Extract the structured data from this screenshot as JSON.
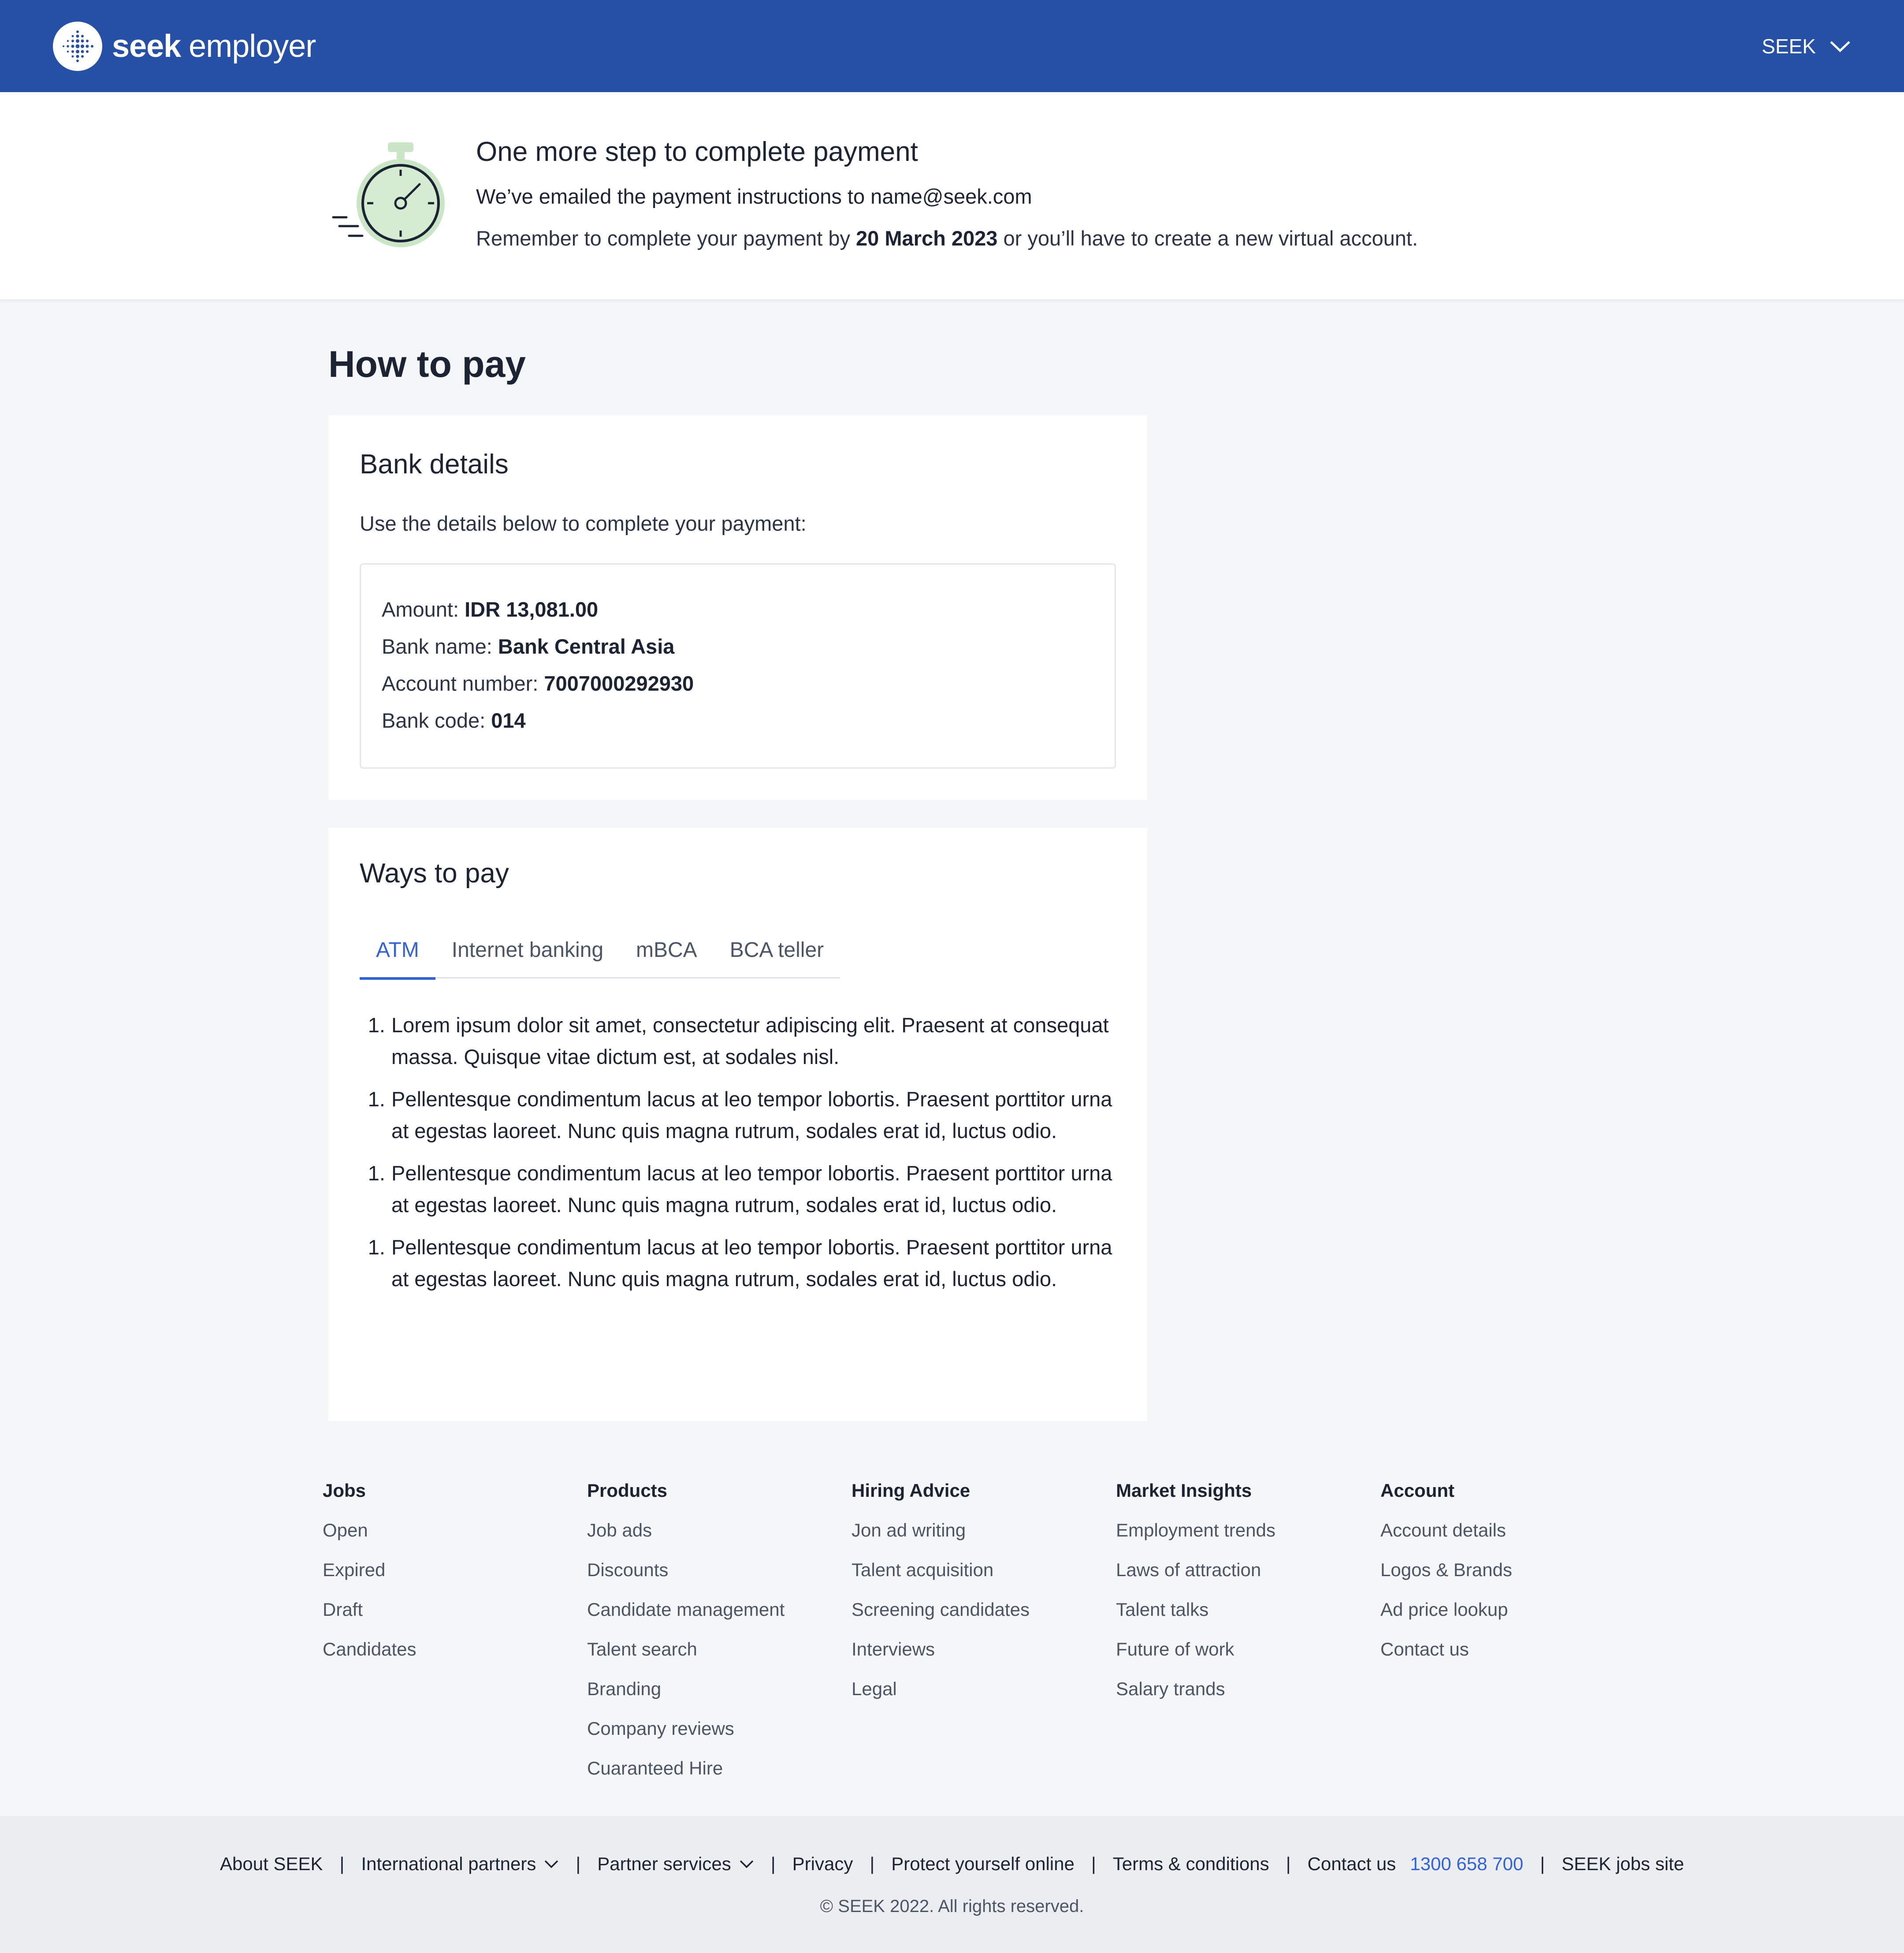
{
  "header": {
    "brand_bold": "seek",
    "brand_light": "employer",
    "account_menu_label": "SEEK"
  },
  "banner": {
    "title": "One more step to complete payment",
    "email_line": "We’ve emailed the payment instructions to name@seek.com",
    "reminder_prefix": "Remember to complete your payment by ",
    "reminder_date": "20 March 2023",
    "reminder_suffix": " or you’ll have to create a new virtual account."
  },
  "page": {
    "title": "How to pay"
  },
  "bank_details": {
    "title": "Bank details",
    "subtitle": "Use the details below to complete your payment:",
    "rows": [
      {
        "label": "Amount: ",
        "value": "IDR 13,081.00"
      },
      {
        "label": "Bank name: ",
        "value": "Bank Central Asia"
      },
      {
        "label": "Account number: ",
        "value": "7007000292930"
      },
      {
        "label": "Bank code: ",
        "value": "014"
      }
    ]
  },
  "ways_to_pay": {
    "title": "Ways to pay",
    "tabs": [
      {
        "label": "ATM",
        "active": true
      },
      {
        "label": "Internet banking",
        "active": false
      },
      {
        "label": "mBCA",
        "active": false
      },
      {
        "label": "BCA teller",
        "active": false
      }
    ],
    "steps": [
      {
        "num": "1.",
        "text": "Lorem ipsum dolor sit amet, consectetur adipiscing elit. Praesent at consequat massa. Quisque vitae dictum est, at sodales nisl."
      },
      {
        "num": "1.",
        "text": "Pellentesque condimentum lacus at leo tempor lobortis. Praesent porttitor urna at egestas laoreet. Nunc quis magna rutrum, sodales erat id, luctus odio."
      },
      {
        "num": "1.",
        "text": "Pellentesque condimentum lacus at leo tempor lobortis. Praesent porttitor urna at egestas laoreet. Nunc quis magna rutrum, sodales erat id, luctus odio."
      },
      {
        "num": "1.",
        "text": "Pellentesque condimentum lacus at leo tempor lobortis. Praesent porttitor urna at egestas laoreet. Nunc quis magna rutrum, sodales erat id, luctus odio."
      }
    ]
  },
  "footer": {
    "columns": [
      {
        "heading": "Jobs",
        "items": [
          "Open",
          "Expired",
          "Draft",
          "Candidates"
        ]
      },
      {
        "heading": "Products",
        "items": [
          "Job ads",
          "Discounts",
          "Candidate management",
          "Talent search",
          "Branding",
          "Company reviews",
          "Cuaranteed Hire"
        ]
      },
      {
        "heading": "Hiring Advice",
        "items": [
          "Jon ad writing",
          "Talent acquisition",
          "Screening candidates",
          "Interviews",
          "Legal"
        ]
      },
      {
        "heading": "Market Insights",
        "items": [
          "Employment trends",
          "Laws of attraction",
          "Talent talks",
          "Future of work",
          "Salary trands"
        ]
      },
      {
        "heading": "Account",
        "items": [
          "Account details",
          "Logos & Brands",
          "Ad price lookup",
          "Contact us"
        ]
      }
    ],
    "bottom_links": {
      "about": "About SEEK",
      "international": "International partners",
      "partner_services": "Partner services",
      "privacy": "Privacy",
      "protect": "Protect yourself online",
      "terms": "Terms & conditions",
      "contact": "Contact us",
      "phone": "1300 658 700",
      "jobs_site": "SEEK jobs site",
      "separator": "|"
    },
    "copyright": "© SEEK 2022. All rights reserved."
  },
  "colors": {
    "header_bg": "#2550a6",
    "accent": "#3463d6",
    "page_bg": "#f5f6f8",
    "bottombar_bg": "#ebedf1"
  }
}
